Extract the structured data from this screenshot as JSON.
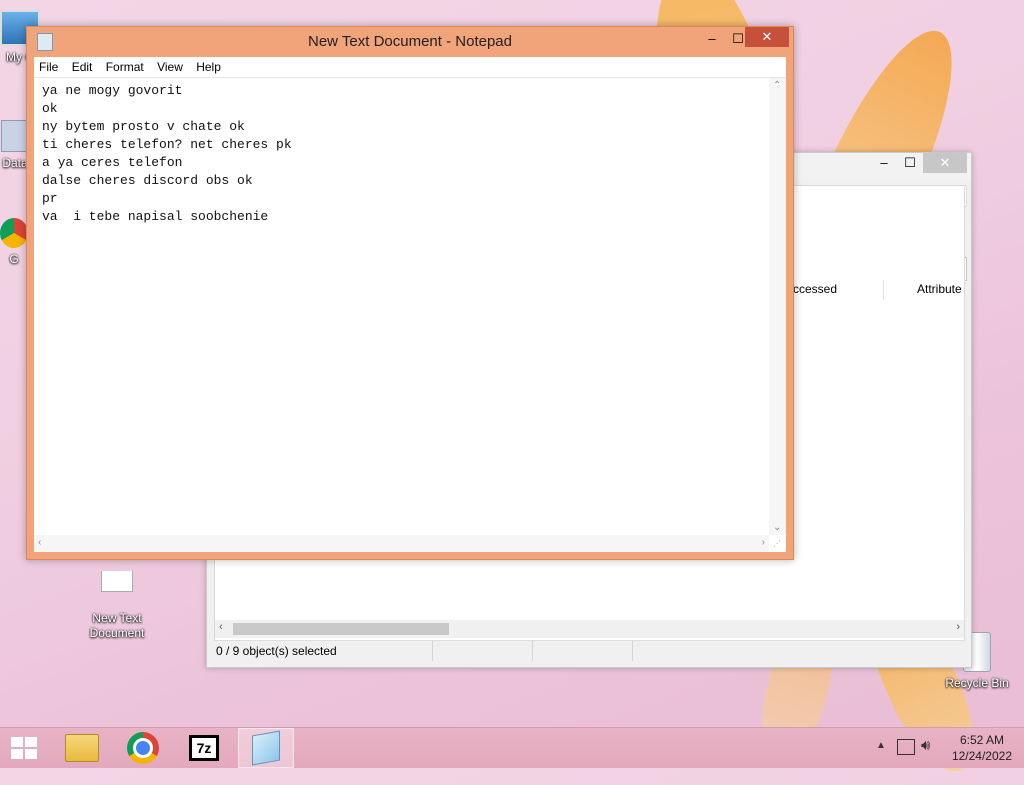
{
  "notepad": {
    "title": "New Text Document - Notepad",
    "menu": [
      "File",
      "Edit",
      "Format",
      "View",
      "Help"
    ],
    "content": "ya ne mogy govorit\nok\nny bytem prosto v chate ok\nti cheres telefon? net cheres pk\na ya ceres telefon\ndalse cheres discord obs ok\npr\nva  i tebe napisal soobchenie"
  },
  "explorer": {
    "col_accessed": "ccessed",
    "col_attributes": "Attribute",
    "status": "0 / 9 object(s) selected"
  },
  "desktop": {
    "icons": {
      "mycomputer": "My C",
      "data": "Data",
      "chrome_partial": "G",
      "newtext": "New Text\nDocument",
      "recycle": "Recycle Bin"
    }
  },
  "taskbar": {
    "time": "6:52 AM",
    "date": "12/24/2022"
  },
  "icons": {
    "windows": "windows-logo-icon",
    "explorer": "file-explorer-icon",
    "chrome": "chrome-icon",
    "sevenzip": "7zip-icon",
    "notepad": "notepad-icon"
  }
}
